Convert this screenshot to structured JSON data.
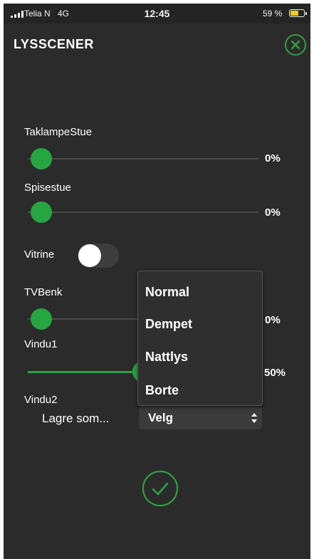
{
  "status_bar": {
    "carrier": "Telia N",
    "network": "4G",
    "time": "12:45",
    "battery_percent_label": "59 %",
    "battery_level": 0.59,
    "battery_color": "#f2cc1e"
  },
  "header": {
    "title": "LYSSCENER",
    "close_icon": "close-circle-icon"
  },
  "lights": [
    {
      "label": "TaklampeStue",
      "value_label": "0%",
      "level": 0
    },
    {
      "label": "Spisestue",
      "value_label": "0%",
      "level": 0
    },
    {
      "label": "Vitrine",
      "switch_on": false
    },
    {
      "label": "TVBenk",
      "value_label": "0%",
      "level": 0
    },
    {
      "label": "Vindu1",
      "value_label": "50%",
      "level": 0.5
    },
    {
      "label": "Vindu2"
    }
  ],
  "save": {
    "label": "Lagre som...",
    "selected": "Velg",
    "options": [
      "Normal",
      "Dempet",
      "Nattlys",
      "Borte"
    ]
  },
  "confirm_icon": "checkmark-circle-icon",
  "colors": {
    "accent": "#26a641",
    "background": "#2b2b2b"
  }
}
